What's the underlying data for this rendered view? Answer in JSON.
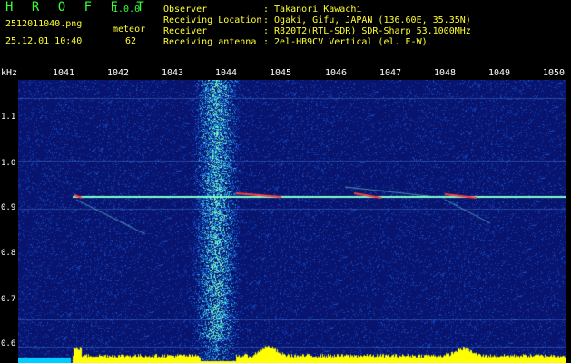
{
  "header": {
    "app_name": "H R O F F T",
    "version": "1.0.0",
    "filename": "2512011040.png",
    "mode": "meteor",
    "datetime": "25.12.01 10:40",
    "count": "62",
    "fields": [
      {
        "label": "Observer",
        "value": ": Takanori Kawachi"
      },
      {
        "label": "Receiving Location",
        "value": ": Ogaki, Gifu, JAPAN (136.60E, 35.35N)"
      },
      {
        "label": "Receiver",
        "value": ": R820T2(RTL-SDR) SDR-Sharp 53.1000MHz"
      },
      {
        "label": "Receiving antenna",
        "value": ": 2el-HB9CV Vertical (el. E-W)"
      }
    ]
  },
  "axis": {
    "x_ticks": [
      "1041",
      "1042",
      "1043",
      "1044",
      "1045",
      "1046",
      "1047",
      "1048",
      "1049",
      "1050"
    ],
    "y_unit": "kHz",
    "y_ticks": [
      "1.1",
      "1.0",
      "0.9",
      "0.8",
      "0.7",
      "0.6"
    ]
  },
  "colors": {
    "background": "#000000",
    "label_yellow": "#ffff33",
    "label_green": "#33ff33",
    "spectrogram_base": "#0a1a7a",
    "signal": "#4df0c0",
    "meteor": "#ff3030",
    "power_trace": "#ffff00"
  }
}
